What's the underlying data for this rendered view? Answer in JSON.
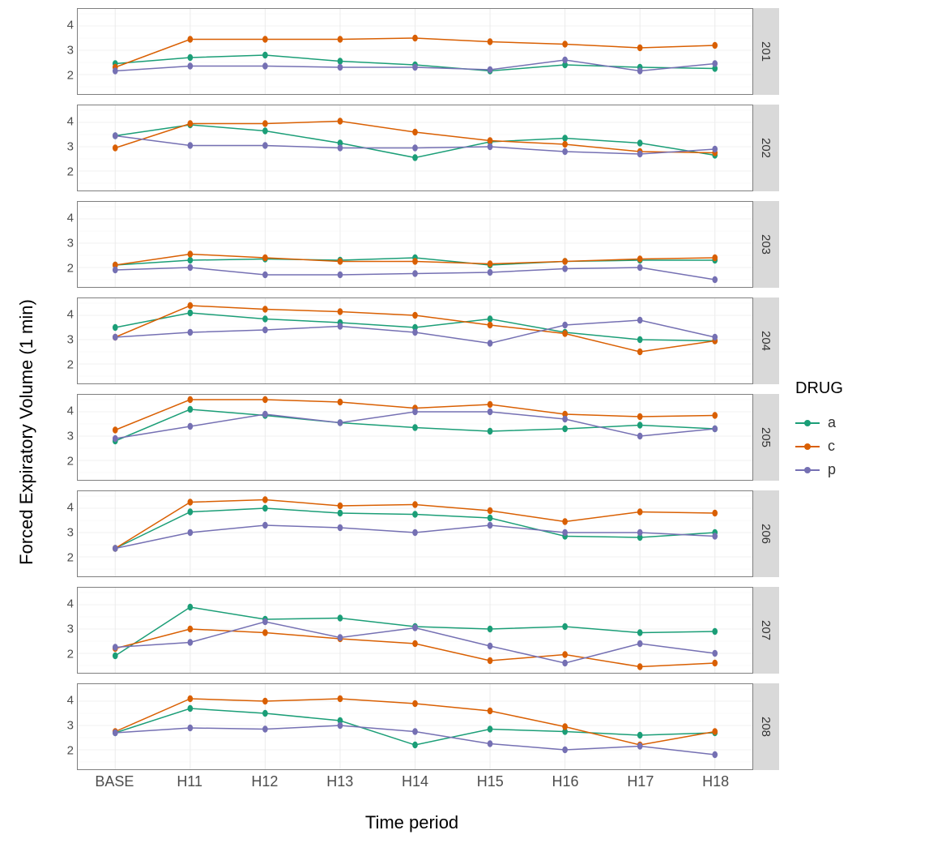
{
  "axis": {
    "y_title": "Forced Expiratory Volume (1 min)",
    "x_title": "Time period",
    "y_ticks": [
      2,
      3,
      4
    ],
    "y_range": [
      1.2,
      4.7
    ],
    "categories": [
      "BASE",
      "H11",
      "H12",
      "H13",
      "H14",
      "H15",
      "H16",
      "H17",
      "H18"
    ]
  },
  "legend": {
    "title": "DRUG",
    "items": [
      {
        "key": "a",
        "label": "a",
        "color": "#1b9e77"
      },
      {
        "key": "c",
        "label": "c",
        "color": "#d95f02"
      },
      {
        "key": "p",
        "label": "p",
        "color": "#7570b3"
      }
    ]
  },
  "colors": {
    "a": "#1b9e77",
    "c": "#d95f02",
    "p": "#7570b3"
  },
  "chart_data": [
    {
      "facet": "201",
      "series": {
        "a": [
          2.45,
          2.7,
          2.8,
          2.55,
          2.4,
          2.15,
          2.4,
          2.3,
          2.25
        ],
        "c": [
          2.3,
          3.45,
          3.45,
          3.45,
          3.5,
          3.35,
          3.25,
          3.1,
          3.2
        ],
        "p": [
          2.15,
          2.35,
          2.35,
          2.3,
          2.3,
          2.2,
          2.6,
          2.15,
          2.45
        ]
      }
    },
    {
      "facet": "202",
      "series": {
        "a": [
          3.45,
          3.9,
          3.65,
          3.15,
          2.55,
          3.2,
          3.35,
          3.15,
          2.65
        ],
        "c": [
          2.95,
          3.95,
          3.95,
          4.05,
          3.6,
          3.25,
          3.1,
          2.8,
          2.75
        ],
        "p": [
          3.45,
          3.05,
          3.05,
          2.95,
          2.95,
          3.0,
          2.8,
          2.7,
          2.9
        ]
      }
    },
    {
      "facet": "203",
      "series": {
        "a": [
          2.1,
          2.3,
          2.35,
          2.3,
          2.4,
          2.1,
          2.25,
          2.3,
          2.3
        ],
        "c": [
          2.1,
          2.55,
          2.4,
          2.25,
          2.25,
          2.15,
          2.25,
          2.35,
          2.4
        ],
        "p": [
          1.9,
          2.0,
          1.7,
          1.7,
          1.75,
          1.8,
          1.95,
          2.0,
          1.5
        ]
      }
    },
    {
      "facet": "204",
      "series": {
        "a": [
          3.5,
          4.1,
          3.85,
          3.7,
          3.5,
          3.85,
          3.3,
          3.0,
          2.95
        ],
        "c": [
          3.1,
          4.4,
          4.25,
          4.15,
          4.0,
          3.6,
          3.25,
          2.5,
          2.95
        ],
        "p": [
          3.1,
          3.3,
          3.4,
          3.55,
          3.3,
          2.85,
          3.6,
          3.8,
          3.1
        ]
      }
    },
    {
      "facet": "205",
      "series": {
        "a": [
          2.8,
          4.1,
          3.85,
          3.55,
          3.35,
          3.2,
          3.3,
          3.45,
          3.3
        ],
        "c": [
          3.25,
          4.5,
          4.5,
          4.4,
          4.15,
          4.3,
          3.9,
          3.8,
          3.85
        ],
        "p": [
          2.9,
          3.4,
          3.9,
          3.55,
          4.0,
          4.0,
          3.7,
          3.0,
          3.3
        ]
      }
    },
    {
      "facet": "206",
      "series": {
        "a": [
          2.35,
          3.85,
          4.0,
          3.8,
          3.75,
          3.6,
          2.85,
          2.8,
          3.0
        ],
        "c": [
          2.35,
          4.25,
          4.35,
          4.1,
          4.15,
          3.9,
          3.45,
          3.85,
          3.8
        ],
        "p": [
          2.35,
          3.0,
          3.3,
          3.2,
          3.0,
          3.3,
          3.0,
          3.0,
          2.85
        ]
      }
    },
    {
      "facet": "207",
      "series": {
        "a": [
          1.9,
          3.9,
          3.4,
          3.45,
          3.1,
          3.0,
          3.1,
          2.85,
          2.9
        ],
        "c": [
          2.2,
          3.0,
          2.85,
          2.6,
          2.4,
          1.7,
          1.95,
          1.45,
          1.6
        ],
        "p": [
          2.25,
          2.45,
          3.3,
          2.65,
          3.05,
          2.3,
          1.6,
          2.4,
          2.0
        ]
      }
    },
    {
      "facet": "208",
      "series": {
        "a": [
          2.7,
          3.7,
          3.5,
          3.2,
          2.2,
          2.85,
          2.75,
          2.6,
          2.7
        ],
        "c": [
          2.75,
          4.1,
          4.0,
          4.1,
          3.9,
          3.6,
          2.95,
          2.2,
          2.75
        ],
        "p": [
          2.7,
          2.9,
          2.85,
          3.0,
          2.75,
          2.25,
          2.0,
          2.15,
          1.8
        ]
      }
    }
  ]
}
